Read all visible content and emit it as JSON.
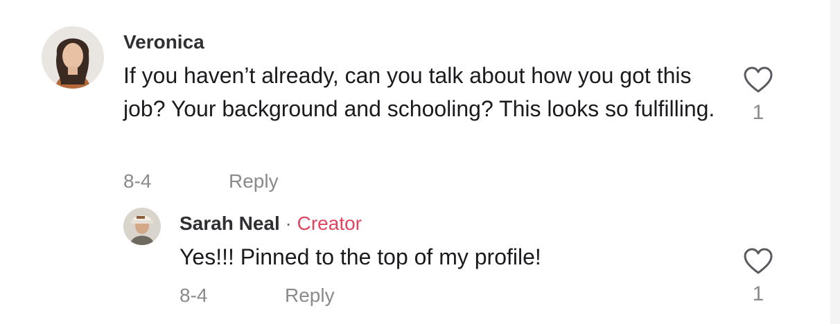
{
  "comments": [
    {
      "username": "Veronica",
      "text": "If you haven’t already, can you talk about how you got this job? Your background and schooling? This looks so fulfilling.",
      "date": "8-4",
      "reply_label": "Reply",
      "likes": "1",
      "icon": "heart-outline-icon"
    },
    {
      "username": "Sarah Neal",
      "separator": "·",
      "badge": "Creator",
      "text": "Yes!!! Pinned to the top of my profile!",
      "date": "8-4",
      "reply_label": "Reply",
      "likes": "1",
      "icon": "heart-outline-icon"
    }
  ],
  "colors": {
    "creator_badge": "#e0455f",
    "muted": "#8a8a8e",
    "text": "#1a1a1f"
  }
}
